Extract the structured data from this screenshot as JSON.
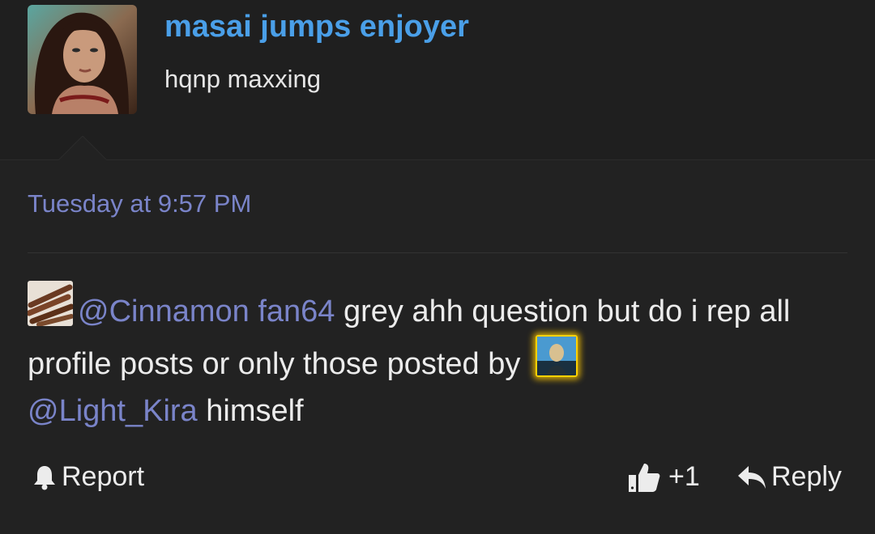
{
  "profile": {
    "username": "masai jumps enjoyer",
    "user_title": "hqnp maxxing",
    "avatar_icon": "profile-photo"
  },
  "post": {
    "timestamp": "Tuesday at 9:57 PM",
    "mention_1": "@Cinnamon fan64",
    "text_1": " grey ahh question but do i rep all profile posts or only those posted by ",
    "mention_2": "@Light_Kira",
    "text_2": " himself"
  },
  "actions": {
    "report_label": "Report",
    "like_count": "+1",
    "reply_label": "Reply"
  },
  "colors": {
    "background": "#222222",
    "header_background": "#1f1f1f",
    "username": "#4a9fe8",
    "link": "#7a84c9",
    "text": "#ececec",
    "highlight_glow": "#ffd200"
  }
}
